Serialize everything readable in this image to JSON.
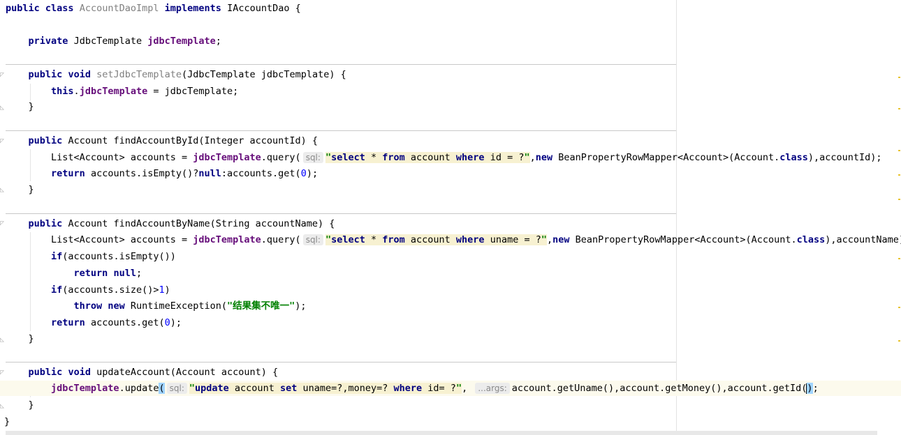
{
  "code": {
    "l1": {
      "kw1": "public",
      "kw2": "class",
      "cls": "AccountDaoImpl",
      "kw3": "implements",
      "iface": "IAccountDao",
      "brace": " {"
    },
    "l3": {
      "kw": "private",
      "type": "JdbcTemplate",
      "field": "jdbcTemplate",
      "semi": ";"
    },
    "l5": {
      "kw1": "public",
      "kw2": "void",
      "method": "setJdbcTemplate",
      "params": "(JdbcTemplate jdbcTemplate) {"
    },
    "l6": {
      "kw": "this",
      "dot": ".",
      "field": "jdbcTemplate",
      "rest": " = jdbcTemplate;"
    },
    "l7": {
      "brace": "}"
    },
    "l9": {
      "kw": "public",
      "sig": "Account findAccountById(Integer accountId) {"
    },
    "l10": {
      "pre": "List<Account> accounts = ",
      "field": "jdbcTemplate",
      "call": ".query(",
      "hint": "sql:",
      "q": "\"",
      "sk1": "select",
      "s1": " * ",
      "sk2": "from",
      "s2": " account ",
      "sk3": "where",
      "s3": " id = ?",
      "q2": "\"",
      "comma": ",",
      "kwnew": "new",
      "post": " BeanPropertyRowMapper<Account>(Account.",
      "kwclass": "class",
      "end": "),accountId);"
    },
    "l11": {
      "kw": "return",
      "a": " accounts.isEmpty()?",
      "kwnull": "null",
      "b": ":accounts.get(",
      "n": "0",
      "c": ");"
    },
    "l12": {
      "brace": "}"
    },
    "l14": {
      "kw": "public",
      "sig": "Account findAccountByName(String accountName) {"
    },
    "l15": {
      "pre": "List<Account> accounts = ",
      "field": "jdbcTemplate",
      "call": ".query(",
      "hint": "sql:",
      "q": "\"",
      "sk1": "select",
      "s1": " * ",
      "sk2": "from",
      "s2": " account ",
      "sk3": "where",
      "s3": " uname = ?",
      "q2": "\"",
      "comma": ",",
      "kwnew": "new",
      "post": " BeanPropertyRowMapper<Account>(Account.",
      "kwclass": "class",
      "end": "),accountName);"
    },
    "l16": {
      "kw": "if",
      "rest": "(accounts.isEmpty())"
    },
    "l17": {
      "kw1": "return",
      "kw2": "null",
      "semi": ";"
    },
    "l18": {
      "kw": "if",
      "a": "(accounts.size()>",
      "n": "1",
      "b": ")"
    },
    "l19": {
      "kw1": "throw",
      "kw2": "new",
      "cls": " RuntimeException(",
      "str": "\"结果集不唯一\"",
      "end": ");"
    },
    "l20": {
      "kw": "return",
      "a": " accounts.get(",
      "n": "0",
      "b": ");"
    },
    "l21": {
      "brace": "}"
    },
    "l23": {
      "kw1": "public",
      "kw2": "void",
      "sig": "updateAccount(Account account) {"
    },
    "l24": {
      "field": "jdbcTemplate",
      "call": ".update",
      "paren": "(",
      "hint": "sql:",
      "q": "\"",
      "sk1": "update",
      "s1": " account ",
      "sk2": "set",
      "s2": " uname=?,money=? ",
      "sk3": "where",
      "s3": " id= ?",
      "q2": "\"",
      "comma": ", ",
      "hint2": "...args:",
      "args": "account.getUname(),account.getMoney(),account.getId(",
      "rparen": ")",
      "end": ";"
    },
    "l25": {
      "brace": "}"
    },
    "l26": {
      "brace": "}"
    }
  },
  "colors": {
    "keyword": "#000080",
    "field": "#660e7a",
    "string": "#008000",
    "number": "#0000ff",
    "current_line": "#fcfaed",
    "sql_bg": "#f7f1d1"
  }
}
